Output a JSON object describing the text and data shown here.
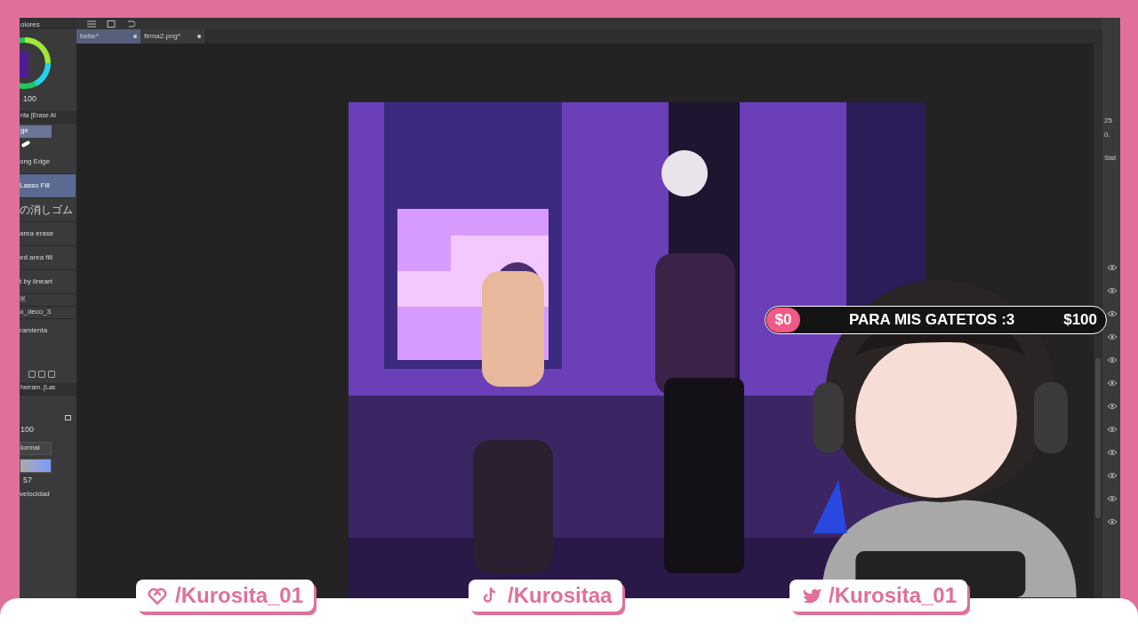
{
  "tabs": [
    {
      "label": "bebe*",
      "selected": true
    },
    {
      "label": "firma2.png*",
      "selected": false
    }
  ],
  "left_panel": {
    "palette_title": "olores",
    "opacity": "100",
    "tool_group": "nta [Erase Al",
    "subtool_tab": "ge",
    "tools": [
      {
        "label": "ong Edge",
        "selected": false
      },
      {
        "label": "Lasso Fill",
        "selected": true
      },
      {
        "label": "の消しゴム",
        "selected": false
      },
      {
        "label": "area erase",
        "selected": false
      },
      {
        "label": "ed area fill",
        "selected": false
      },
      {
        "label": "t by lineart",
        "selected": false
      },
      {
        "label": "※",
        "selected": false
      },
      {
        "label": "o_deco_3",
        "selected": false
      }
    ],
    "new_tool": "ramienta",
    "properties_title": "herram. [Las",
    "size": "100",
    "blend_mode": "lormal",
    "speed": "57",
    "speed_label": "velocidad"
  },
  "right_panel": {
    "value_1": "25",
    "value_2": "0.",
    "section": "Sist"
  },
  "donation_goal": {
    "current": "$0",
    "title": "PARA MIS GATETOS :3",
    "goal": "$100"
  },
  "socials": [
    {
      "kind": "heart",
      "handle": "/Kurosita_01"
    },
    {
      "kind": "tiktok",
      "handle": "/Kurositaa"
    },
    {
      "kind": "bird",
      "handle": "/Kurosita_01"
    }
  ]
}
